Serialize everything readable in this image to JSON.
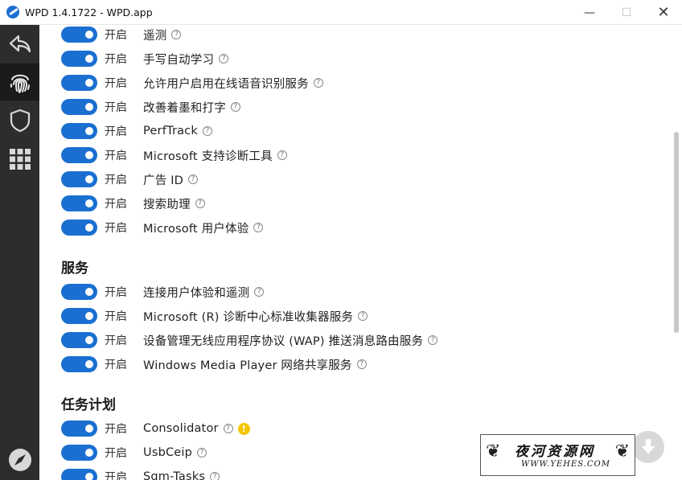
{
  "window": {
    "title": "WPD 1.4.1722 - WPD.app",
    "minimize_glyph": "—",
    "maximize_glyph": "☐",
    "close_glyph": "✕"
  },
  "sidebar": {
    "items": [
      {
        "icon": "back-arrow-icon"
      },
      {
        "icon": "fingerprint-icon",
        "active": true
      },
      {
        "icon": "shield-icon"
      },
      {
        "icon": "grid-icon"
      }
    ],
    "bottom_icon": "compass-icon"
  },
  "toggle_state_label": "开启",
  "telemetry_rows": [
    {
      "label": "遥测"
    },
    {
      "label": "手写自动学习"
    },
    {
      "label": "允许用户启用在线语音识别服务"
    },
    {
      "label": "改善着墨和打字"
    },
    {
      "label": "PerfTrack"
    },
    {
      "label": "Microsoft 支持诊断工具"
    },
    {
      "label": "广告 ID"
    },
    {
      "label": "搜索助理"
    },
    {
      "label": "Microsoft 用户体验"
    }
  ],
  "services": {
    "title": "服务",
    "rows": [
      {
        "label": "连接用户体验和遥测"
      },
      {
        "label": "Microsoft (R) 诊断中心标准收集器服务"
      },
      {
        "label": "设备管理无线应用程序协议 (WAP) 推送消息路由服务"
      },
      {
        "label": "Windows Media Player 网络共享服务"
      }
    ]
  },
  "tasks": {
    "title": "任务计划",
    "rows": [
      {
        "label": "Consolidator",
        "warning": true
      },
      {
        "label": "UsbCeip"
      },
      {
        "label": "Sqm-Tasks"
      }
    ]
  },
  "help_glyph": "?",
  "warning_glyph": "!",
  "colors": {
    "toggle_on": "#1a6fd1",
    "sidebar_bg": "#2d2d30",
    "warning": "#f5c400"
  },
  "watermark": {
    "text": "夜河资源网",
    "url": "WWW.YEHES.COM"
  }
}
